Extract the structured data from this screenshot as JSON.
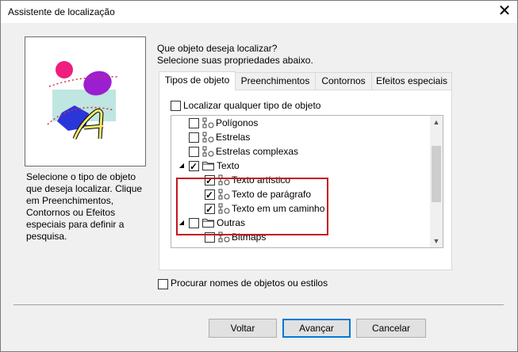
{
  "window": {
    "title": "Assistente de localização"
  },
  "description": "Selecione o tipo de objeto que deseja localizar. Clique em Preenchimentos, Contornos ou Efeitos especiais para definir a pesquisa.",
  "question": {
    "line1": "Que objeto deseja localizar?",
    "line2": "Selecione suas propriedades abaixo."
  },
  "tabs": [
    {
      "label": "Tipos de objeto",
      "active": true
    },
    {
      "label": "Preenchimentos",
      "active": false
    },
    {
      "label": "Contornos",
      "active": false
    },
    {
      "label": "Efeitos especiais",
      "active": false
    }
  ],
  "any_object": {
    "label": "Localizar qualquer tipo de objeto",
    "checked": false
  },
  "tree": [
    {
      "label": "Polígonos",
      "checked": false
    },
    {
      "label": "Estrelas",
      "checked": false
    },
    {
      "label": "Estrelas complexas",
      "checked": false
    },
    {
      "label": "Texto",
      "checked": true,
      "expanded": true,
      "folder": true
    },
    {
      "label": "Texto artístico",
      "checked": true
    },
    {
      "label": "Texto de parágrafo",
      "checked": true
    },
    {
      "label": "Texto em um caminho",
      "checked": true
    },
    {
      "label": "Outras",
      "checked": false,
      "expanded": true,
      "folder": true
    },
    {
      "label": "Bitmaps",
      "checked": false
    }
  ],
  "search_names": {
    "label": "Procurar nomes de objetos ou estilos",
    "checked": false
  },
  "buttons": {
    "back": "Voltar",
    "next": "Avançar",
    "cancel": "Cancelar"
  },
  "colors": {
    "highlight": "#c4161c",
    "default_button_border": "#0078d7"
  }
}
